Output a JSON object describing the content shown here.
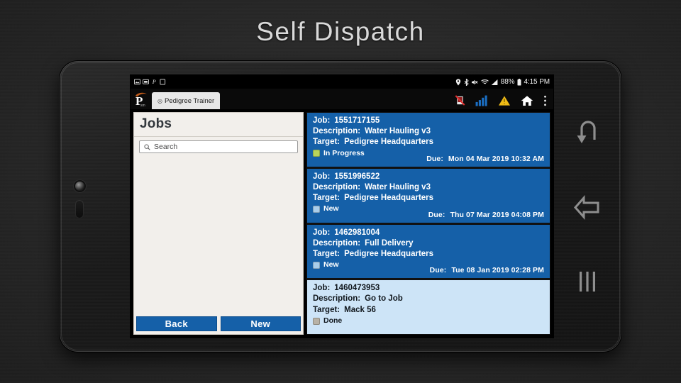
{
  "slide": {
    "title": "Self Dispatch"
  },
  "statusbar": {
    "left_icons": [
      "image-icon",
      "screenshot-icon",
      "p-app-icon",
      "file-icon"
    ],
    "right_icons": [
      "location-icon",
      "bluetooth-icon",
      "mute-icon",
      "wifi-icon",
      "signal-icon"
    ],
    "battery": "88%",
    "battery_icon": "battery-icon",
    "time": "4:15 PM"
  },
  "appbar": {
    "logo": "pedigree-logo-icon",
    "tab_label": "Pedigree Trainer",
    "tab_prefix_icon": "globe-icon",
    "icons": [
      "no-connection-icon",
      "signal-bars-icon",
      "warning-triangle-icon",
      "home-icon",
      "overflow-menu-icon"
    ]
  },
  "left_panel": {
    "title": "Jobs",
    "search": {
      "icon": "search-icon",
      "placeholder": "Search",
      "value": ""
    },
    "buttons": [
      {
        "label": "Back",
        "name": "back-button"
      },
      {
        "label": "New",
        "name": "new-button"
      }
    ]
  },
  "labels": {
    "job": "Job:",
    "description": "Description:",
    "target": "Target:",
    "due": "Due:"
  },
  "colors": {
    "card_blue": "#1560a8",
    "card_selected": "#cde4f7",
    "status_in_progress": "#b9d45a",
    "status_new": "#a9cdea",
    "status_done": "#b8b2a6",
    "button_blue": "#1560a8",
    "panel_bg": "#f2efeb"
  },
  "jobs": [
    {
      "id": "1551717155",
      "description": "Water Hauling v3",
      "target": "Pedigree Headquarters",
      "status": "In Progress",
      "status_color": "#b9d45a",
      "due": "Mon 04 Mar 2019 10:32 AM",
      "selected": false
    },
    {
      "id": "1551996522",
      "description": "Water Hauling v3",
      "target": "Pedigree Headquarters",
      "status": "New",
      "status_color": "#a9cdea",
      "due": "Thu 07 Mar 2019 04:08 PM",
      "selected": false
    },
    {
      "id": "1462981004",
      "description": "Full Delivery",
      "target": "Pedigree Headquarters",
      "status": "New",
      "status_color": "#a9cdea",
      "due": "Tue 08 Jan 2019 02:28 PM",
      "selected": false
    },
    {
      "id": "1460473953",
      "description": "Go to Job",
      "target": "Mack 56",
      "status": "Done",
      "status_color": "#b8b2a6",
      "due": "",
      "selected": true
    }
  ],
  "navbar": {
    "buttons": [
      {
        "name": "undo-icon",
        "label": "Undo"
      },
      {
        "name": "back-arrow-icon",
        "label": "Back"
      },
      {
        "name": "recent-apps-icon",
        "label": "Recents"
      }
    ]
  }
}
